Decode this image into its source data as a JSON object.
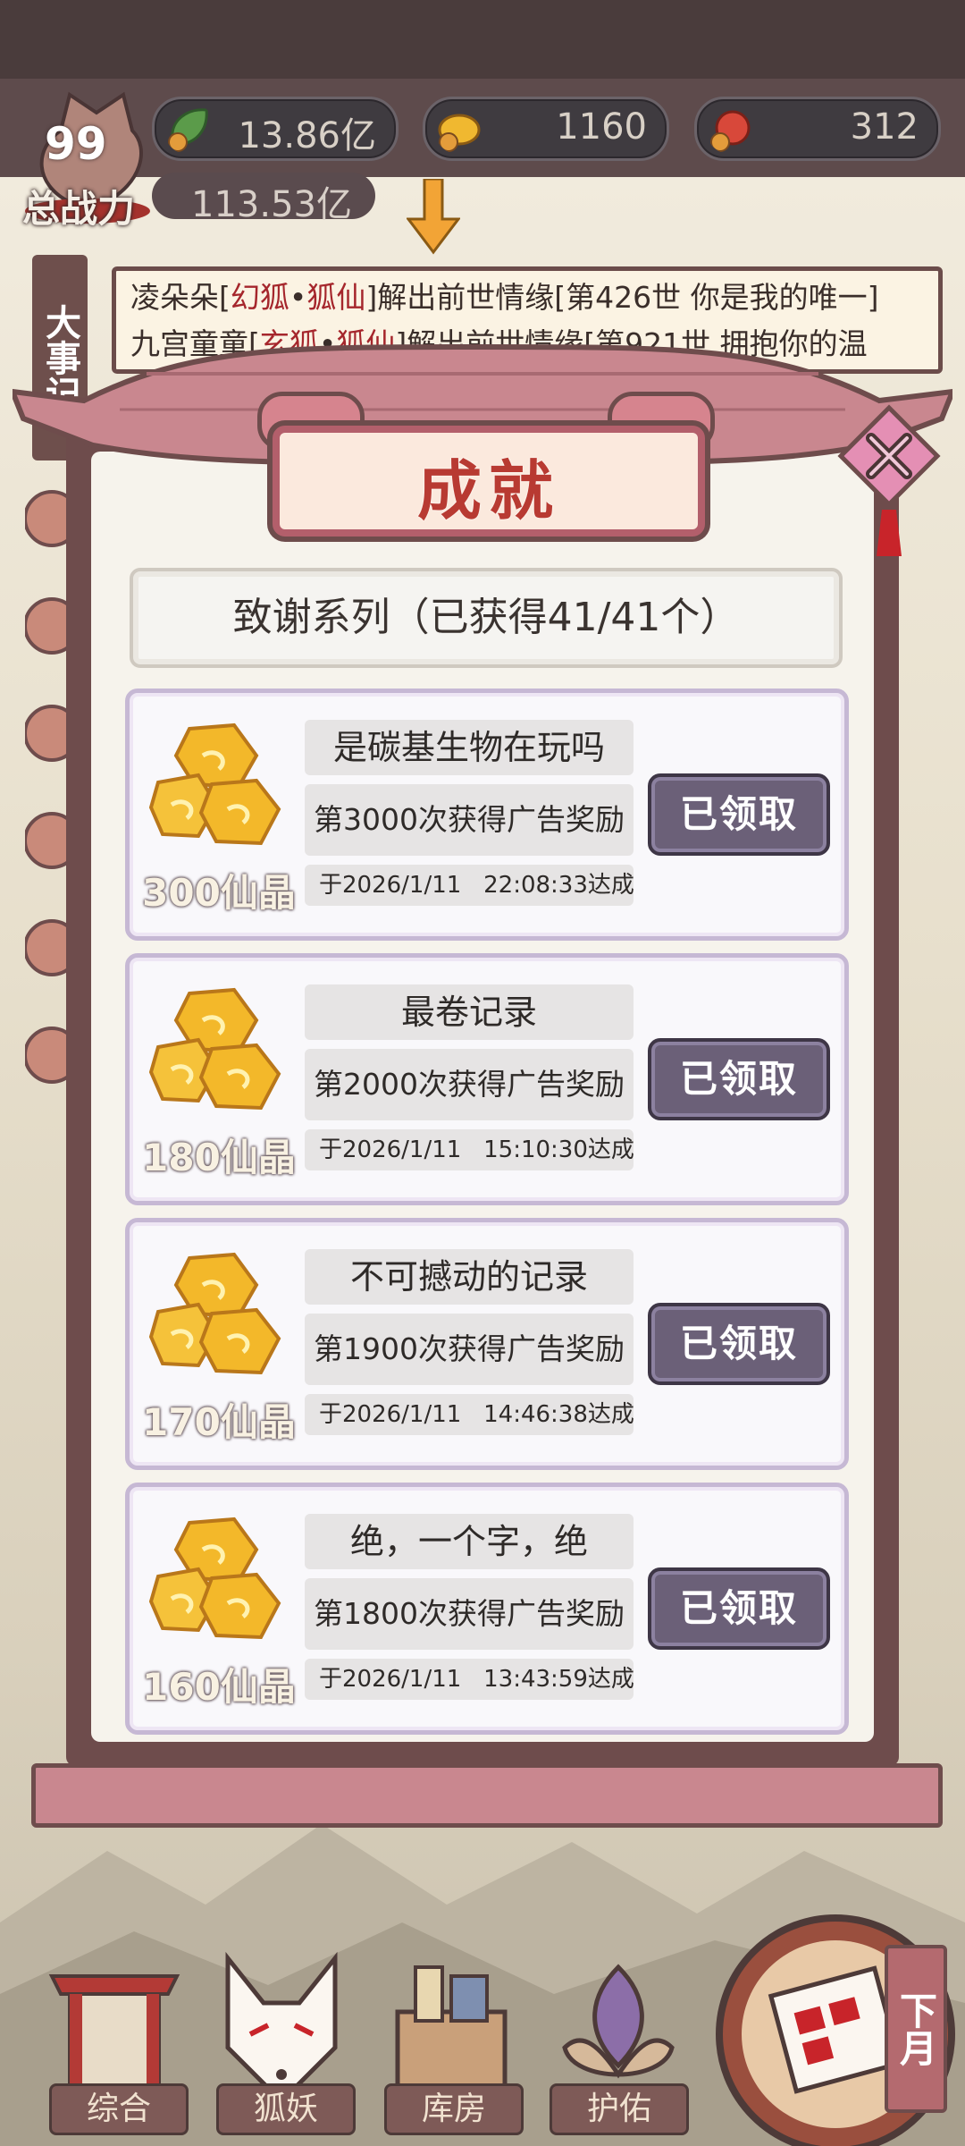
{
  "resources": [
    {
      "icon": "jade-leaf-icon",
      "value": "13.86亿"
    },
    {
      "icon": "gold-ingot-icon",
      "value": "1160"
    },
    {
      "icon": "fruit-icon",
      "value": "312"
    }
  ],
  "power": {
    "level": "99",
    "label": "总战力",
    "value": "113.53亿"
  },
  "ticker": {
    "line1": {
      "name": "凌朵朵[",
      "fox1": "幻狐",
      "dot": "•",
      "fox2": "狐仙",
      "rest": "]解出前世情缘[第426世 你是我的唯一]"
    },
    "line2": {
      "name": "九宫童童[",
      "fox1": "玄狐",
      "dot": "•",
      "fox2": "狐仙",
      "rest": "]解出前世情缘[第921世 拥抱你的温"
    }
  },
  "side_tag": "大事记",
  "panel": {
    "title": "成就",
    "series": "致谢系列（已获得41/41个）"
  },
  "achievements": [
    {
      "title": "是碳基生物在玩吗",
      "desc": "第3000次获得广告奖励",
      "date": "于2026/1/11   22:08:33达成",
      "reward": "300仙晶",
      "status": "已领取"
    },
    {
      "title": "最卷记录",
      "desc": "第2000次获得广告奖励",
      "date": "于2026/1/11   15:10:30达成",
      "reward": "180仙晶",
      "status": "已领取"
    },
    {
      "title": "不可撼动的记录",
      "desc": "第1900次获得广告奖励",
      "date": "于2026/1/11   14:46:38达成",
      "reward": "170仙晶",
      "status": "已领取"
    },
    {
      "title": "绝，一个字，绝",
      "desc": "第1800次获得广告奖励",
      "date": "于2026/1/11   13:43:59达成",
      "reward": "160仙晶",
      "status": "已领取"
    }
  ],
  "nav": [
    {
      "label": "综合",
      "icon": "gate-icon"
    },
    {
      "label": "狐妖",
      "icon": "fox-mask-icon"
    },
    {
      "label": "库房",
      "icon": "storage-icon"
    },
    {
      "label": "护佑",
      "icon": "lotus-icon"
    }
  ],
  "month_tag": "下月",
  "colors": {
    "panel_frame": "#6e4c4c",
    "title_red": "#b83a32",
    "claim_button": "#6b6078",
    "highlight_red": "#a5262c"
  }
}
